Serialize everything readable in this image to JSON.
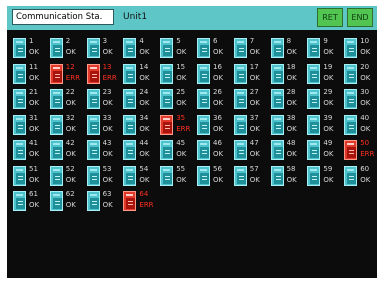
{
  "header": {
    "title": "Communication Sta.",
    "unit": "Unit1",
    "ret_label": "RET",
    "end_label": "END"
  },
  "stations": [
    {
      "num": "1",
      "status": "OK"
    },
    {
      "num": "2",
      "status": "OK"
    },
    {
      "num": "3",
      "status": "OK"
    },
    {
      "num": "4",
      "status": "OK"
    },
    {
      "num": "5",
      "status": "OK"
    },
    {
      "num": "6",
      "status": "OK"
    },
    {
      "num": "7",
      "status": "OK"
    },
    {
      "num": "8",
      "status": "OK"
    },
    {
      "num": "9",
      "status": "OK"
    },
    {
      "num": "10",
      "status": "OK"
    },
    {
      "num": "11",
      "status": "OK"
    },
    {
      "num": "12",
      "status": "ERR"
    },
    {
      "num": "13",
      "status": "ERR"
    },
    {
      "num": "14",
      "status": "OK"
    },
    {
      "num": "15",
      "status": "OK"
    },
    {
      "num": "16",
      "status": "OK"
    },
    {
      "num": "17",
      "status": "OK"
    },
    {
      "num": "18",
      "status": "OK"
    },
    {
      "num": "19",
      "status": "OK"
    },
    {
      "num": "20",
      "status": "OK"
    },
    {
      "num": "21",
      "status": "OK"
    },
    {
      "num": "22",
      "status": "OK"
    },
    {
      "num": "23",
      "status": "OK"
    },
    {
      "num": "24",
      "status": "OK"
    },
    {
      "num": "25",
      "status": "OK"
    },
    {
      "num": "26",
      "status": "OK"
    },
    {
      "num": "27",
      "status": "OK"
    },
    {
      "num": "28",
      "status": "OK"
    },
    {
      "num": "29",
      "status": "OK"
    },
    {
      "num": "30",
      "status": "OK"
    },
    {
      "num": "31",
      "status": "OK"
    },
    {
      "num": "32",
      "status": "OK"
    },
    {
      "num": "33",
      "status": "OK"
    },
    {
      "num": "34",
      "status": "OK"
    },
    {
      "num": "35",
      "status": "ERR"
    },
    {
      "num": "36",
      "status": "OK"
    },
    {
      "num": "37",
      "status": "OK"
    },
    {
      "num": "38",
      "status": "OK"
    },
    {
      "num": "39",
      "status": "OK"
    },
    {
      "num": "40",
      "status": "OK"
    },
    {
      "num": "41",
      "status": "OK"
    },
    {
      "num": "42",
      "status": "OK"
    },
    {
      "num": "43",
      "status": "OK"
    },
    {
      "num": "44",
      "status": "OK"
    },
    {
      "num": "45",
      "status": "OK"
    },
    {
      "num": "46",
      "status": "OK"
    },
    {
      "num": "47",
      "status": "OK"
    },
    {
      "num": "48",
      "status": "OK"
    },
    {
      "num": "49",
      "status": "OK"
    },
    {
      "num": "50",
      "status": "ERR"
    },
    {
      "num": "51",
      "status": "OK"
    },
    {
      "num": "52",
      "status": "OK"
    },
    {
      "num": "53",
      "status": "OK"
    },
    {
      "num": "54",
      "status": "OK"
    },
    {
      "num": "55",
      "status": "OK"
    },
    {
      "num": "56",
      "status": "OK"
    },
    {
      "num": "57",
      "status": "OK"
    },
    {
      "num": "58",
      "status": "OK"
    },
    {
      "num": "59",
      "status": "OK"
    },
    {
      "num": "60",
      "status": "OK"
    },
    {
      "num": "61",
      "status": "OK"
    },
    {
      "num": "62",
      "status": "OK"
    },
    {
      "num": "63",
      "status": "OK"
    },
    {
      "num": "64",
      "status": "ERR"
    }
  ],
  "colors": {
    "header_bg": "#5ec6c6",
    "panel_bg": "#0c0c0c",
    "ok_icon": "#4ec2cc",
    "err_icon": "#e23a2a",
    "err_text": "#ff3020",
    "button_green": "#52c452"
  },
  "icons": {
    "station": "station-unit-icon"
  }
}
